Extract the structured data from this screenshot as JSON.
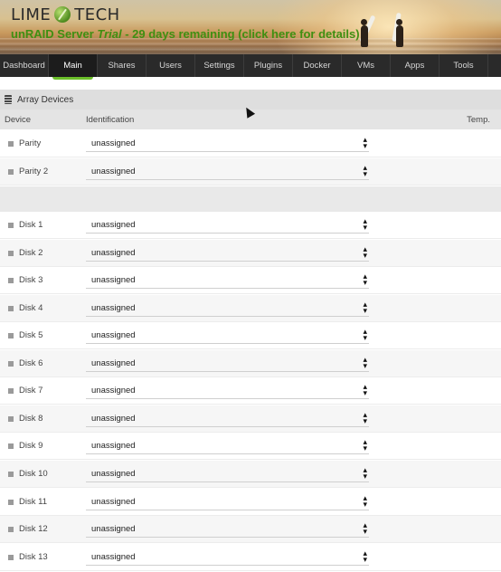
{
  "header": {
    "logo_left": "LIME",
    "logo_right": "TECH",
    "trial_prefix": "unRAID Server ",
    "trial_em": "Trial",
    "trial_suffix": " - 29 days remaining (click here for details)"
  },
  "nav": {
    "items": [
      "Dashboard",
      "Main",
      "Shares",
      "Users",
      "Settings",
      "Plugins",
      "Docker",
      "VMs",
      "Apps",
      "Tools"
    ],
    "active": "Main"
  },
  "section": {
    "title": "Array Devices"
  },
  "columns": {
    "device": "Device",
    "identification": "Identification",
    "temp": "Temp."
  },
  "parity_rows": [
    {
      "device": "Parity",
      "value": "unassigned"
    },
    {
      "device": "Parity 2",
      "value": "unassigned"
    }
  ],
  "disk_rows": [
    {
      "device": "Disk 1",
      "value": "unassigned"
    },
    {
      "device": "Disk 2",
      "value": "unassigned"
    },
    {
      "device": "Disk 3",
      "value": "unassigned"
    },
    {
      "device": "Disk 4",
      "value": "unassigned"
    },
    {
      "device": "Disk 5",
      "value": "unassigned"
    },
    {
      "device": "Disk 6",
      "value": "unassigned"
    },
    {
      "device": "Disk 7",
      "value": "unassigned"
    },
    {
      "device": "Disk 8",
      "value": "unassigned"
    },
    {
      "device": "Disk 9",
      "value": "unassigned"
    },
    {
      "device": "Disk 10",
      "value": "unassigned"
    },
    {
      "device": "Disk 11",
      "value": "unassigned"
    },
    {
      "device": "Disk 12",
      "value": "unassigned"
    },
    {
      "device": "Disk 13",
      "value": "unassigned"
    }
  ],
  "colors": {
    "accent": "#6bbf2a",
    "trial_text": "#3f8f12",
    "nav_bg": "#2a2a2a"
  }
}
